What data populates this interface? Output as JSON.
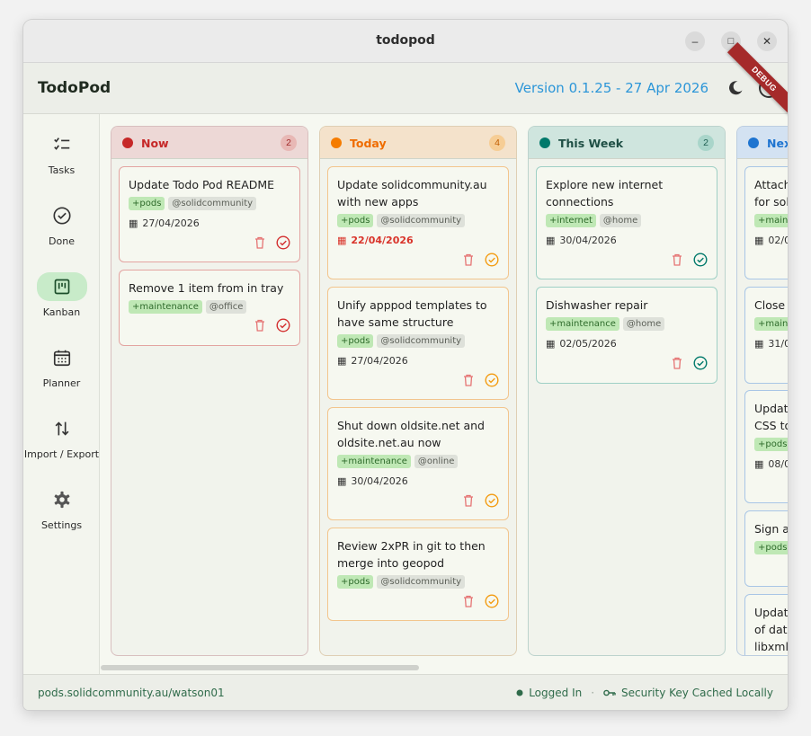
{
  "window": {
    "title": "todopod",
    "minimize": "–",
    "maximize": "□",
    "close": "✕"
  },
  "appbar": {
    "app_name": "TodoPod",
    "version": "Version 0.1.25 - 27 Apr 2026",
    "debug_banner": "DEBUG"
  },
  "sidebar": {
    "items": [
      {
        "label": "Tasks",
        "icon": "checklist-icon",
        "active": false
      },
      {
        "label": "Done",
        "icon": "check-circle-icon",
        "active": false
      },
      {
        "label": "Kanban",
        "icon": "kanban-icon",
        "active": true
      },
      {
        "label": "Planner",
        "icon": "calendar-icon",
        "active": false
      },
      {
        "label": "Import / Export",
        "icon": "import-export-icon",
        "active": false
      },
      {
        "label": "Settings",
        "icon": "gear-icon",
        "active": false
      }
    ]
  },
  "colors": {
    "now": "#d32f2f",
    "today": "#f57c00",
    "week": "#00796b",
    "next": "#1e74d0"
  },
  "columns": [
    {
      "title": "Now",
      "count": "2",
      "cards": [
        {
          "title": "Update Todo Pod README",
          "tags": [
            "+pods",
            "@solidcommunity"
          ],
          "due": "27/04/2026",
          "overdue": false
        },
        {
          "title": "Remove 1 item from in tray",
          "tags": [
            "+maintenance",
            "@office"
          ],
          "due": "",
          "overdue": false
        }
      ]
    },
    {
      "title": "Today",
      "count": "4",
      "cards": [
        {
          "title": "Update solidcommunity.au with new apps",
          "tags": [
            "+pods",
            "@solidcommunity"
          ],
          "due": "22/04/2026",
          "overdue": true
        },
        {
          "title": "Unify apppod templates to have same structure",
          "tags": [
            "+pods",
            "@solidcommunity"
          ],
          "due": "27/04/2026",
          "overdue": false
        },
        {
          "title": "Shut down oldsite.net and oldsite.net.au now",
          "tags": [
            "+maintenance",
            "@online"
          ],
          "due": "30/04/2026",
          "overdue": false
        },
        {
          "title": "Review 2xPR in git to then merge into geopod",
          "tags": [
            "+pods",
            "@solidcommunity"
          ],
          "due": "",
          "overdue": false
        }
      ]
    },
    {
      "title": "This Week",
      "count": "2",
      "cards": [
        {
          "title": "Explore new internet connections",
          "tags": [
            "+internet",
            "@home"
          ],
          "due": "30/04/2026",
          "overdue": false
        },
        {
          "title": "Dishwasher repair",
          "tags": [
            "+maintenance",
            "@home"
          ],
          "due": "02/05/2026",
          "overdue": false
        }
      ]
    },
    {
      "title": "Next",
      "count": "",
      "cards": [
        {
          "title": "Attach\nfor sol",
          "tags": [
            "+maint"
          ],
          "due": "02/0",
          "overdue": false
        },
        {
          "title": "Close",
          "tags": [
            "+maint"
          ],
          "due": "31/0",
          "overdue": false
        },
        {
          "title": "Update\nCSS to",
          "tags": [
            "+pods"
          ],
          "due": "08/0",
          "overdue": false
        },
        {
          "title": "Sign a",
          "tags": [
            "+pods"
          ],
          "due": "",
          "overdue": false
        },
        {
          "title": "Update\nof date\nlibxml",
          "tags": [],
          "due": "",
          "overdue": false
        }
      ]
    }
  ],
  "footer": {
    "pod_path": "pods.solidcommunity.au/watson01",
    "login_status": "Logged In",
    "separator": "·",
    "key_status": "Security Key Cached Locally"
  }
}
